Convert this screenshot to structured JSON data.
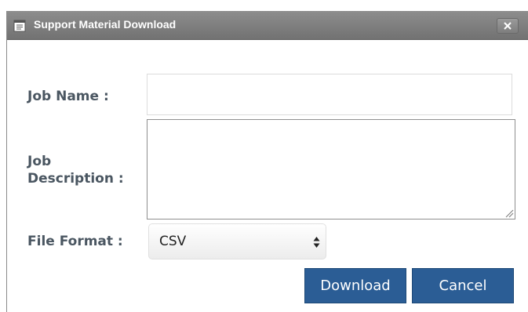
{
  "dialog": {
    "title": "Support Material Download",
    "close_icon": "close-icon",
    "title_icon": "document-icon"
  },
  "form": {
    "job_name_label": "Job Name :",
    "job_name_value": "",
    "job_description_label_line1": "Job",
    "job_description_label_line2": "Description :",
    "job_description_value": "",
    "file_format_label": "File Format :",
    "file_format_selected": "CSV"
  },
  "buttons": {
    "download": "Download",
    "cancel": "Cancel"
  },
  "colors": {
    "titlebar": "#7f7f7f",
    "button": "#2b5d95",
    "label": "#4a5661"
  }
}
